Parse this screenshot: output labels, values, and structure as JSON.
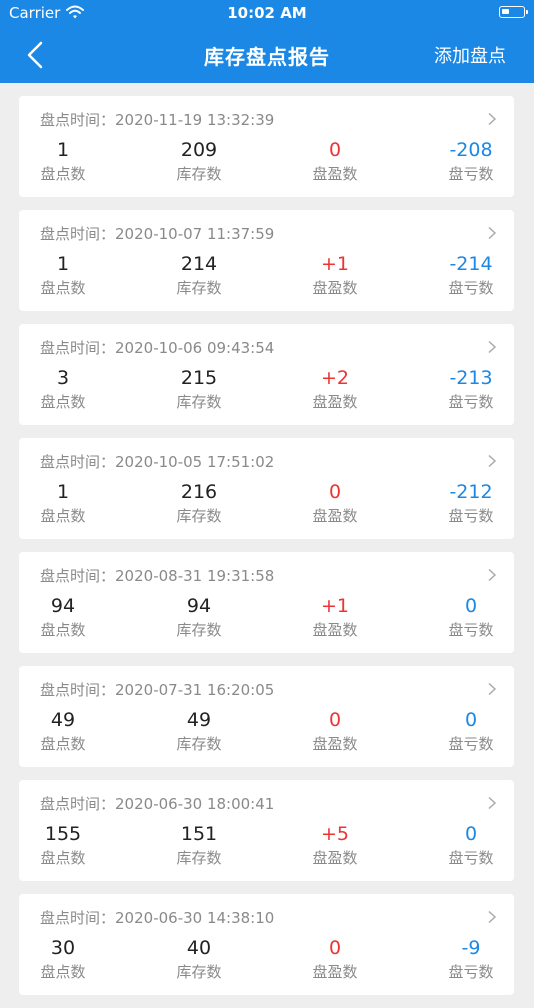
{
  "status_bar": {
    "carrier": "Carrier",
    "time": "10:02 AM"
  },
  "nav": {
    "title": "库存盘点报告",
    "action": "添加盘点"
  },
  "labels": {
    "time_prefix": "盘点时间：",
    "count": "盘点数",
    "stock": "库存数",
    "surplus": "盘盈数",
    "loss": "盘亏数"
  },
  "records": [
    {
      "time": "2020-11-19 13:32:39",
      "count": "1",
      "stock": "209",
      "surplus": "0",
      "loss": "-208"
    },
    {
      "time": "2020-10-07 11:37:59",
      "count": "1",
      "stock": "214",
      "surplus": "+1",
      "loss": "-214"
    },
    {
      "time": "2020-10-06 09:43:54",
      "count": "3",
      "stock": "215",
      "surplus": "+2",
      "loss": "-213"
    },
    {
      "time": "2020-10-05 17:51:02",
      "count": "1",
      "stock": "216",
      "surplus": "0",
      "loss": "-212"
    },
    {
      "time": "2020-08-31 19:31:58",
      "count": "94",
      "stock": "94",
      "surplus": "+1",
      "loss": "0"
    },
    {
      "time": "2020-07-31 16:20:05",
      "count": "49",
      "stock": "49",
      "surplus": "0",
      "loss": "0"
    },
    {
      "time": "2020-06-30 18:00:41",
      "count": "155",
      "stock": "151",
      "surplus": "+5",
      "loss": "0"
    },
    {
      "time": "2020-06-30 14:38:10",
      "count": "30",
      "stock": "40",
      "surplus": "0",
      "loss": "-9"
    }
  ],
  "colors": {
    "accent": "#1a88e4",
    "surplus": "#ee3333",
    "background": "#eeeeee"
  }
}
